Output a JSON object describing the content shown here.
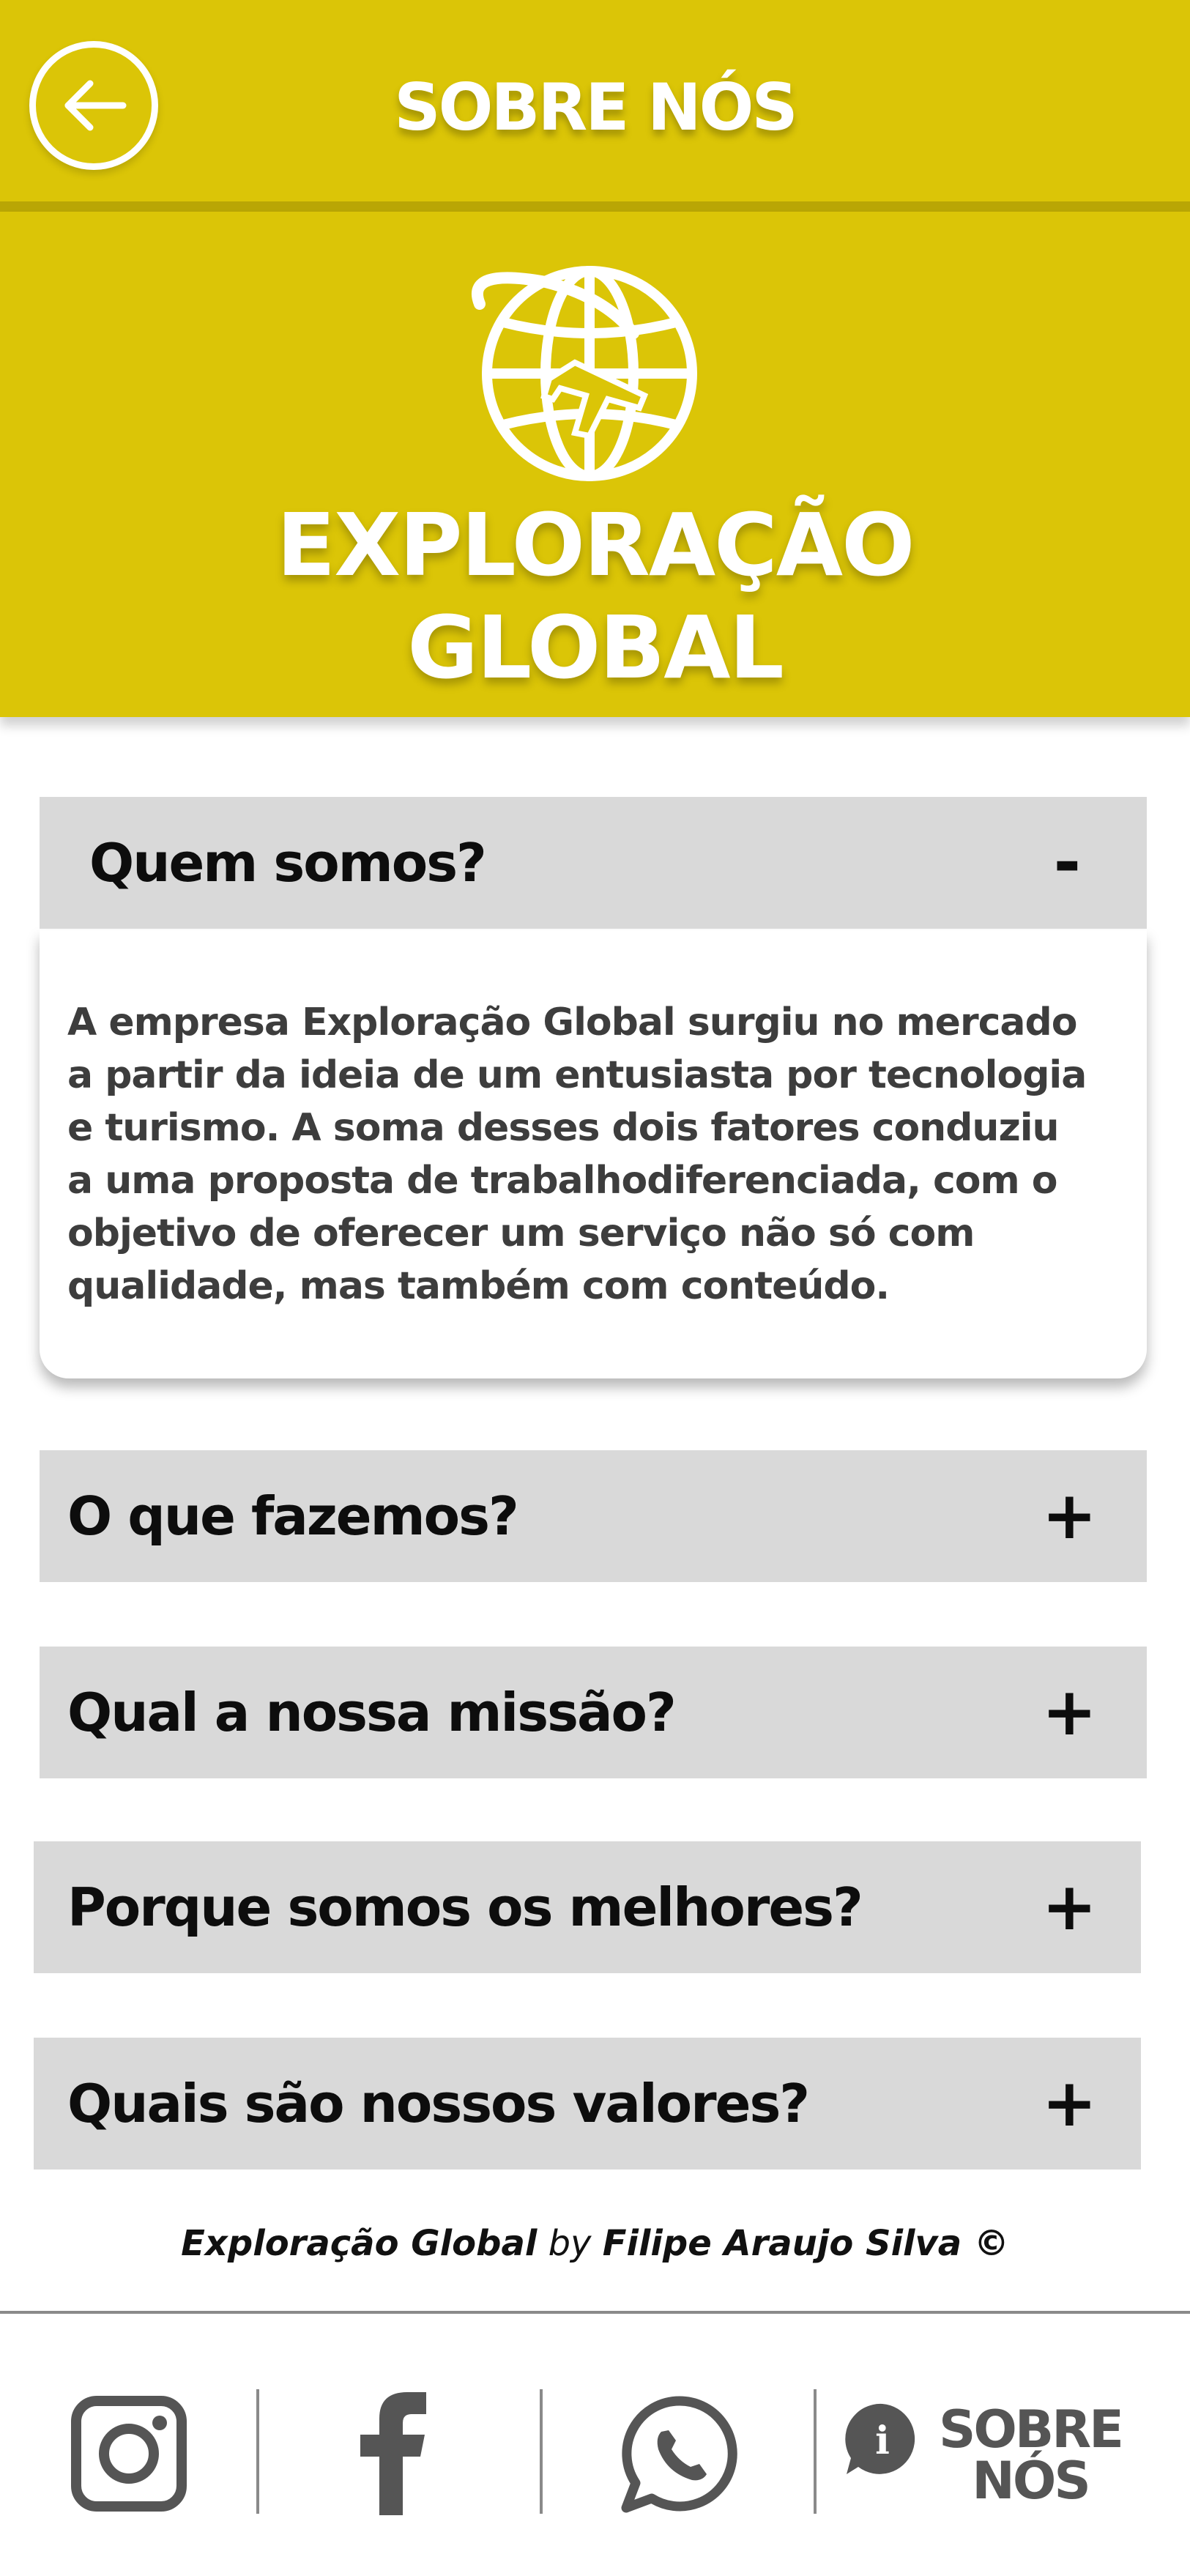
{
  "header": {
    "title": "SOBRE NÓS",
    "back_icon": "arrow-left-icon"
  },
  "hero": {
    "brand_line1": "EXPLORAÇÃO",
    "brand_line2": "GLOBAL",
    "logo_icon": "globe-airplane-icon"
  },
  "accordion": [
    {
      "question": "Quem somos?",
      "symbol": "-",
      "expanded": true,
      "answer": "A empresa Exploração Global surgiu no mercado\na  partir da ideia de um entusiasta por tecnologia\ne turismo. A soma desses dois fatores conduziu\na uma proposta de trabalhodiferenciada, com o\nobjetivo de oferecer um serviço não só com\nqualidade, mas também com conteúdo."
    },
    {
      "question": "O que fazemos?",
      "symbol": "+",
      "expanded": false
    },
    {
      "question": "Qual a nossa missão?",
      "symbol": "+",
      "expanded": false
    },
    {
      "question": "Porque somos os melhores?",
      "symbol": "+",
      "expanded": false
    },
    {
      "question": "Quais são nossos valores?",
      "symbol": "+",
      "expanded": false
    }
  ],
  "footer": {
    "brand": "Exploração Global",
    "by": "by",
    "author": "Filipe Araujo Silva ©"
  },
  "bottom_nav": {
    "instagram_icon": "instagram-icon",
    "facebook_icon": "facebook-icon",
    "whatsapp_icon": "whatsapp-icon",
    "about_icon": "info-bubble-icon",
    "about_line1": "SOBRE",
    "about_line2": "NÓS"
  },
  "colors": {
    "primary": "#dbc507",
    "accordion_bg": "#d9d9d9",
    "text_dark": "#0d0d0d"
  }
}
